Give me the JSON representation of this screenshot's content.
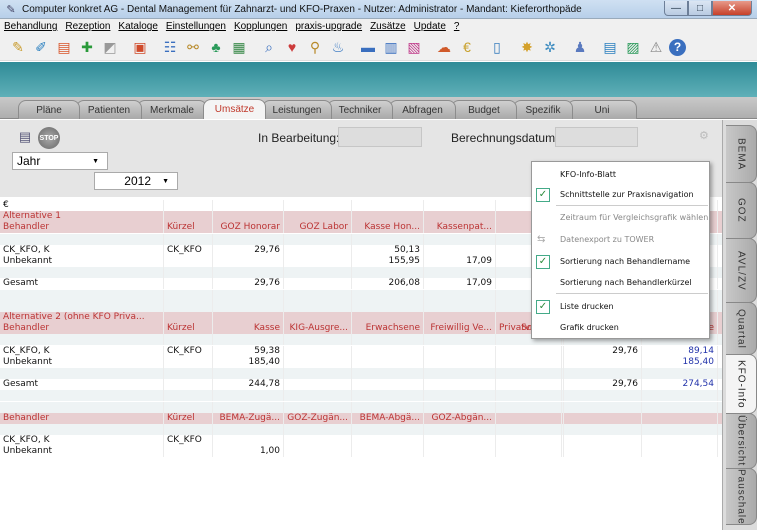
{
  "window": {
    "title": "Computer konkret AG - Dental Management für Zahnarzt- und KFO-Praxen - Nutzer: Administrator - Mandant: Kieferorthopäde",
    "minimize": "—",
    "maximize": "□",
    "close": "✕"
  },
  "menu": [
    "Behandlung",
    "Rezeption",
    "Kataloge",
    "Einstellungen",
    "Kopplungen",
    "praxis-upgrade",
    "Zusätze",
    "Update",
    "?"
  ],
  "toolbar_icons": [
    {
      "name": "pen-icon",
      "glyph": "✎",
      "color": "#c89a2a"
    },
    {
      "name": "toothbrush-icon",
      "glyph": "✐",
      "color": "#2a7fbf"
    },
    {
      "name": "document-icon",
      "glyph": "▤",
      "color": "#d8552a"
    },
    {
      "name": "medical-cross-icon",
      "glyph": "✚",
      "color": "#2a9a3a"
    },
    {
      "name": "xray-icon",
      "glyph": "◩",
      "color": "#999"
    },
    {
      "name": "monitor-icon",
      "glyph": "▣",
      "color": "#d04a2a"
    },
    {
      "name": "person-list-icon",
      "glyph": "☷",
      "color": "#3a6fbf"
    },
    {
      "name": "link-icon",
      "glyph": "⚯",
      "color": "#b88a2a"
    },
    {
      "name": "people-icon",
      "glyph": "♣",
      "color": "#2a9a5a"
    },
    {
      "name": "chart-icon",
      "glyph": "▦",
      "color": "#3a8a4a"
    },
    {
      "name": "tooth-search-icon",
      "glyph": "⌕",
      "color": "#3a6fbf"
    },
    {
      "name": "tooth-icon",
      "glyph": "♥",
      "color": "#cc3a3a"
    },
    {
      "name": "magnifier-icon",
      "glyph": "⚲",
      "color": "#b88a2a"
    },
    {
      "name": "bottle-icon",
      "glyph": "♨",
      "color": "#2a6fbf"
    },
    {
      "name": "folder-icon",
      "glyph": "▬",
      "color": "#3a6fbf"
    },
    {
      "name": "calendar-icon",
      "glyph": "▥",
      "color": "#3a6fbf"
    },
    {
      "name": "calculator-icon",
      "glyph": "▧",
      "color": "#c03a8a"
    },
    {
      "name": "cloud-icon",
      "glyph": "☁",
      "color": "#d05a2a"
    },
    {
      "name": "coin-icon",
      "glyph": "€",
      "color": "#c8a02a"
    },
    {
      "name": "book-icon",
      "glyph": "▯",
      "color": "#3a7fbf"
    },
    {
      "name": "star-icon",
      "glyph": "✸",
      "color": "#d4a02a"
    },
    {
      "name": "settings-icon",
      "glyph": "✲",
      "color": "#3a8abf"
    },
    {
      "name": "person-icon",
      "glyph": "♟",
      "color": "#5a7abf"
    },
    {
      "name": "panel-icon",
      "glyph": "▤",
      "color": "#2a7fbf"
    },
    {
      "name": "image-icon",
      "glyph": "▨",
      "color": "#2a9a5a"
    },
    {
      "name": "warning-icon",
      "glyph": "⚠",
      "color": "#888"
    },
    {
      "name": "help-icon",
      "glyph": "?",
      "color": "#fff"
    }
  ],
  "tabs": [
    {
      "label": "Pläne",
      "name": "tab-plaene"
    },
    {
      "label": "Patienten",
      "name": "tab-patienten"
    },
    {
      "label": "Merkmale",
      "name": "tab-merkmale"
    },
    {
      "label": "Umsätze",
      "name": "tab-umsaetze",
      "active": true
    },
    {
      "label": "Leistungen",
      "name": "tab-leistungen"
    },
    {
      "label": "Techniker",
      "name": "tab-techniker"
    },
    {
      "label": "Abfragen",
      "name": "tab-abfragen"
    },
    {
      "label": "Budget",
      "name": "tab-budget"
    },
    {
      "label": "Spezifik",
      "name": "tab-spezifik"
    },
    {
      "label": "Uni",
      "name": "tab-uni"
    }
  ],
  "side_tabs": [
    {
      "label": "BEMA",
      "name": "sidetab-bema"
    },
    {
      "label": "GOZ",
      "name": "sidetab-goz"
    },
    {
      "label": "AVL/ZV",
      "name": "sidetab-avl-zv"
    },
    {
      "label": "Quartal",
      "name": "sidetab-quartal"
    },
    {
      "label": "KFO-Info",
      "name": "sidetab-kfo-info",
      "active": true
    },
    {
      "label": "Übersicht",
      "name": "sidetab-uebersicht"
    },
    {
      "label": "Pauschale",
      "name": "sidetab-pauschale"
    }
  ],
  "filter": {
    "stop_label": "STOP",
    "in_bearbeitung_label": "In Bearbeitung:",
    "berechnungsdatum_label": "Berechnungsdatum:",
    "period_value": "Jahr",
    "year_value": "2012"
  },
  "grid": {
    "rows": [
      {
        "type": "plain",
        "cells": [
          "€",
          "",
          "",
          "",
          "",
          "",
          "",
          "",
          "",
          ""
        ]
      },
      {
        "type": "hdr",
        "cells": [
          "Alternative 1",
          "",
          "",
          "",
          "",
          "",
          "",
          "",
          "",
          ""
        ]
      },
      {
        "type": "hdr",
        "cells": [
          "Behandler",
          "Kürzel",
          "GOZ Honorar",
          "GOZ Labor",
          "Kasse Hon...",
          "Kassenpat...",
          "Pat.-A",
          "",
          "",
          ""
        ]
      },
      {
        "type": "gap",
        "cells": [
          "",
          "",
          "",
          "",
          "",
          "",
          "",
          "",
          "",
          ""
        ]
      },
      {
        "type": "plain",
        "cells": [
          "CK_KFO, K",
          "CK_KFO",
          "29,76",
          "",
          "50,13",
          "",
          "",
          "",
          "",
          ""
        ]
      },
      {
        "type": "plain",
        "cells": [
          "Unbekannt",
          "",
          "",
          "",
          "155,95",
          "17,09",
          "",
          "",
          "",
          ""
        ]
      },
      {
        "type": "gap",
        "cells": [
          "",
          "",
          "",
          "",
          "",
          "",
          "",
          "",
          "",
          ""
        ]
      },
      {
        "type": "plain",
        "cells": [
          "Gesamt",
          "",
          "29,76",
          "",
          "206,08",
          "17,09",
          "",
          "",
          "",
          ""
        ]
      },
      {
        "type": "gap",
        "cells": [
          "",
          "",
          "",
          "",
          "",
          "",
          "",
          "",
          "",
          ""
        ]
      },
      {
        "type": "gap",
        "cells": [
          "",
          "",
          "",
          "",
          "",
          "",
          "",
          "",
          "",
          ""
        ]
      },
      {
        "type": "hdr",
        "cells": [
          "Alternative 2 (ohne KFO Priva...",
          "",
          "",
          "",
          "",
          "",
          "",
          "",
          "",
          ""
        ]
      },
      {
        "type": "hdr",
        "cells": [
          "Behandler",
          "Kürzel",
          "Kasse",
          "KIG-Ausgre...",
          "Erwachsene",
          "Freiwillig Ve...",
          "Sonstige",
          "Privatversic...",
          "",
          "Summe"
        ]
      },
      {
        "type": "gap",
        "cells": [
          "",
          "",
          "",
          "",
          "",
          "",
          "",
          "",
          "",
          ""
        ]
      },
      {
        "type": "plain",
        "cells": [
          "CK_KFO, K",
          "CK_KFO",
          "59,38",
          "",
          "",
          "",
          "",
          "",
          "29,76",
          "89,14"
        ]
      },
      {
        "type": "plain",
        "cells": [
          "Unbekannt",
          "",
          "185,40",
          "",
          "",
          "",
          "",
          "",
          "",
          "185,40"
        ]
      },
      {
        "type": "gap",
        "cells": [
          "",
          "",
          "",
          "",
          "",
          "",
          "",
          "",
          "",
          ""
        ]
      },
      {
        "type": "plain",
        "cells": [
          "Gesamt",
          "",
          "244,78",
          "",
          "",
          "",
          "",
          "",
          "29,76",
          "274,54"
        ]
      },
      {
        "type": "gap",
        "cells": [
          "",
          "",
          "",
          "",
          "",
          "",
          "",
          "",
          "",
          ""
        ]
      },
      {
        "type": "gap",
        "cells": [
          "",
          "",
          "",
          "",
          "",
          "",
          "",
          "",
          "",
          ""
        ]
      },
      {
        "type": "hdr",
        "cells": [
          "Behandler",
          "Kürzel",
          "BEMA-Zugä...",
          "GOZ-Zugän...",
          "BEMA-Abgä...",
          "GOZ-Abgän...",
          "",
          "",
          "",
          ""
        ]
      },
      {
        "type": "gap",
        "cells": [
          "",
          "",
          "",
          "",
          "",
          "",
          "",
          "",
          "",
          ""
        ]
      },
      {
        "type": "plain",
        "cells": [
          "CK_KFO, K",
          "CK_KFO",
          "",
          "",
          "",
          "",
          "",
          "",
          "",
          ""
        ]
      },
      {
        "type": "plain",
        "cells": [
          "Unbekannt",
          "",
          "1,00",
          "",
          "",
          "",
          "",
          "",
          "",
          ""
        ]
      }
    ]
  },
  "context_menu": [
    {
      "label": "KFO-Info-Blatt",
      "checked": false,
      "disabled": false
    },
    {
      "label": "Schnittstelle zur Praxisnavigation",
      "checked": true,
      "disabled": false
    },
    {
      "label": "Zeitraum für Vergleichsgrafik wählen",
      "checked": false,
      "disabled": true
    },
    {
      "label": "Datenexport zu TOWER",
      "checked": false,
      "disabled": true,
      "icon": true
    },
    {
      "label": "Sortierung nach Behandlername",
      "checked": true,
      "disabled": false
    },
    {
      "label": "Sortierung nach Behandlerkürzel",
      "checked": false,
      "disabled": false
    },
    {
      "label": "Liste drucken",
      "checked": true,
      "disabled": false
    },
    {
      "label": "Grafik drucken",
      "checked": false,
      "disabled": false
    }
  ],
  "colors": {
    "accent_teal": "#3a9aa5",
    "header_row": "#e8cfd1",
    "header_text": "#b33",
    "active_tab_text": "#c0392b"
  }
}
